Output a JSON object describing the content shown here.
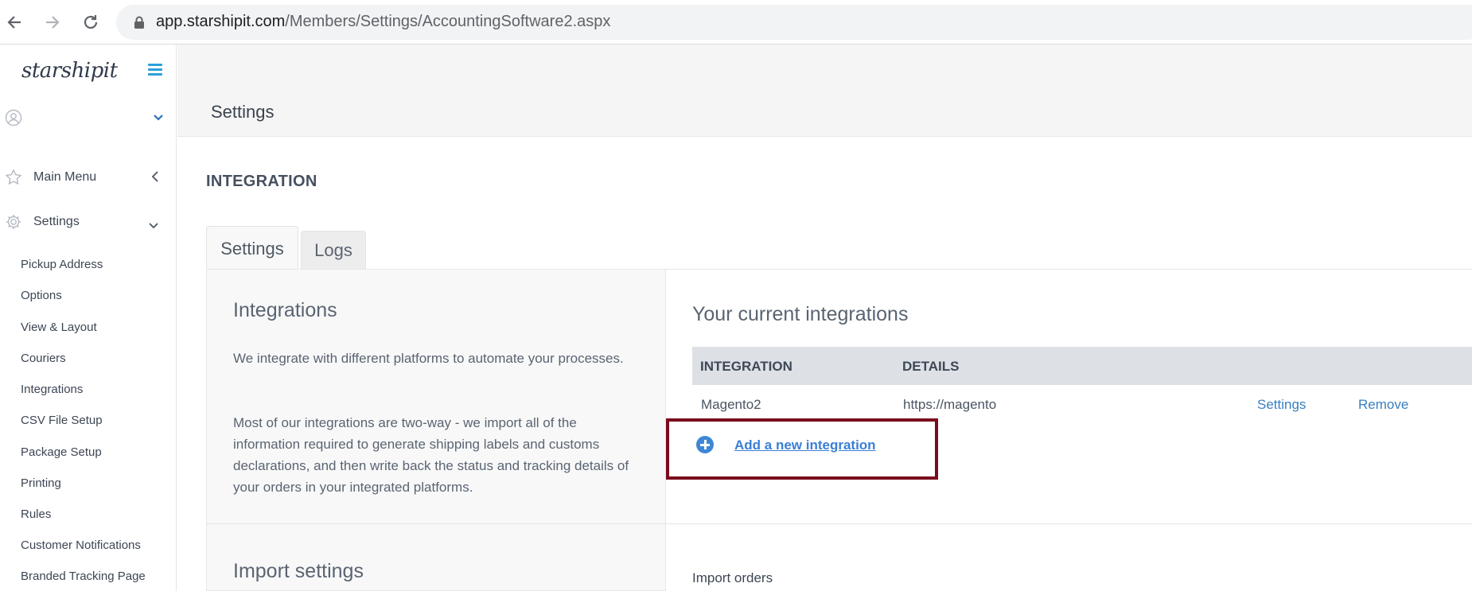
{
  "browser": {
    "url_host": "app.starshipit.com",
    "url_path": "/Members/Settings/AccountingSoftware2.aspx",
    "back_icon": "back-arrow-icon",
    "forward_icon": "forward-arrow-icon",
    "reload_icon": "reload-icon",
    "lock_icon": "lock-icon"
  },
  "sidebar": {
    "logo": "starshipit",
    "accent_color": "#2aa0d8",
    "main_menu_label": "Main Menu",
    "settings_label": "Settings",
    "sub_items": [
      "Pickup Address",
      "Options",
      "View & Layout",
      "Couriers",
      "Integrations",
      "CSV File Setup",
      "Package Setup",
      "Printing",
      "Rules",
      "Customer Notifications",
      "Branded Tracking Page"
    ]
  },
  "header": {
    "title": "Settings"
  },
  "main": {
    "section_title": "INTEGRATION",
    "tabs": [
      {
        "label": "Settings",
        "active": true
      },
      {
        "label": "Logs",
        "active": false
      }
    ],
    "left_panel": {
      "heading": "Integrations",
      "para1": "We integrate with different platforms to automate your processes.",
      "para2": "Most of our integrations are two-way - we import all of the information required to generate shipping labels and customs declarations, and then write back the status and tracking details of your orders in your integrated platforms.",
      "import_heading": "Import settings"
    },
    "right_panel": {
      "heading": "Your current integrations",
      "columns": [
        "INTEGRATION",
        "DETAILS"
      ],
      "rows": [
        {
          "integration": "Magento2",
          "details": "https://magento",
          "settings_link": "Settings",
          "remove_link": "Remove"
        }
      ],
      "add_link": "Add a new integration",
      "import_orders_label": "Import orders",
      "highlight_color": "#7a0c1c",
      "link_color": "#3a7fd6"
    }
  }
}
